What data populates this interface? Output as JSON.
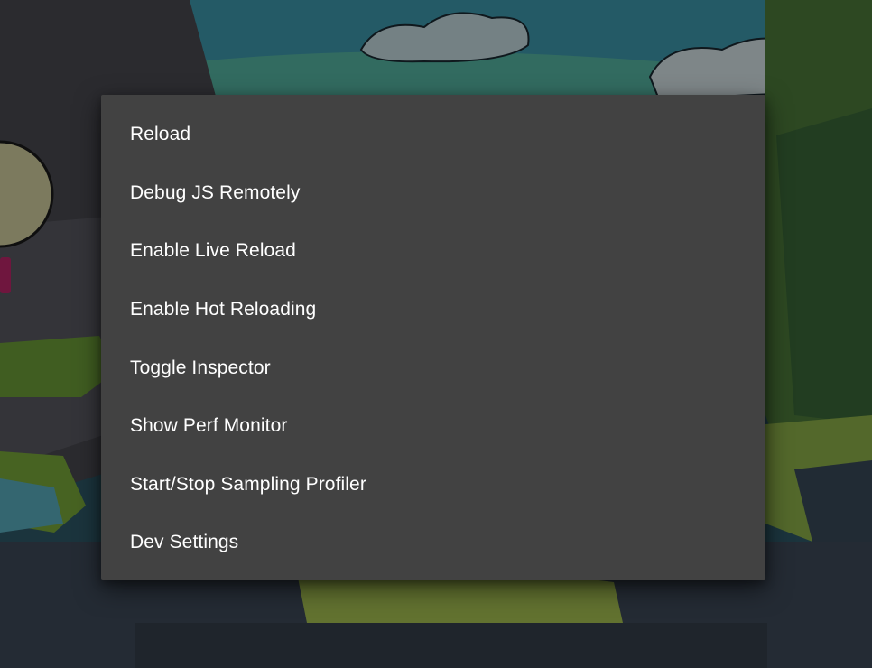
{
  "dev_menu": {
    "items": [
      {
        "label": "Reload"
      },
      {
        "label": "Debug JS Remotely"
      },
      {
        "label": "Enable Live Reload"
      },
      {
        "label": "Enable Hot Reloading"
      },
      {
        "label": "Toggle Inspector"
      },
      {
        "label": "Show Perf Monitor"
      },
      {
        "label": "Start/Stop Sampling Profiler"
      },
      {
        "label": "Dev Settings"
      }
    ]
  },
  "colors": {
    "dialog_background": "#424242",
    "item_text": "#ffffff",
    "scrim": "rgba(0,0,0,0.42)"
  }
}
